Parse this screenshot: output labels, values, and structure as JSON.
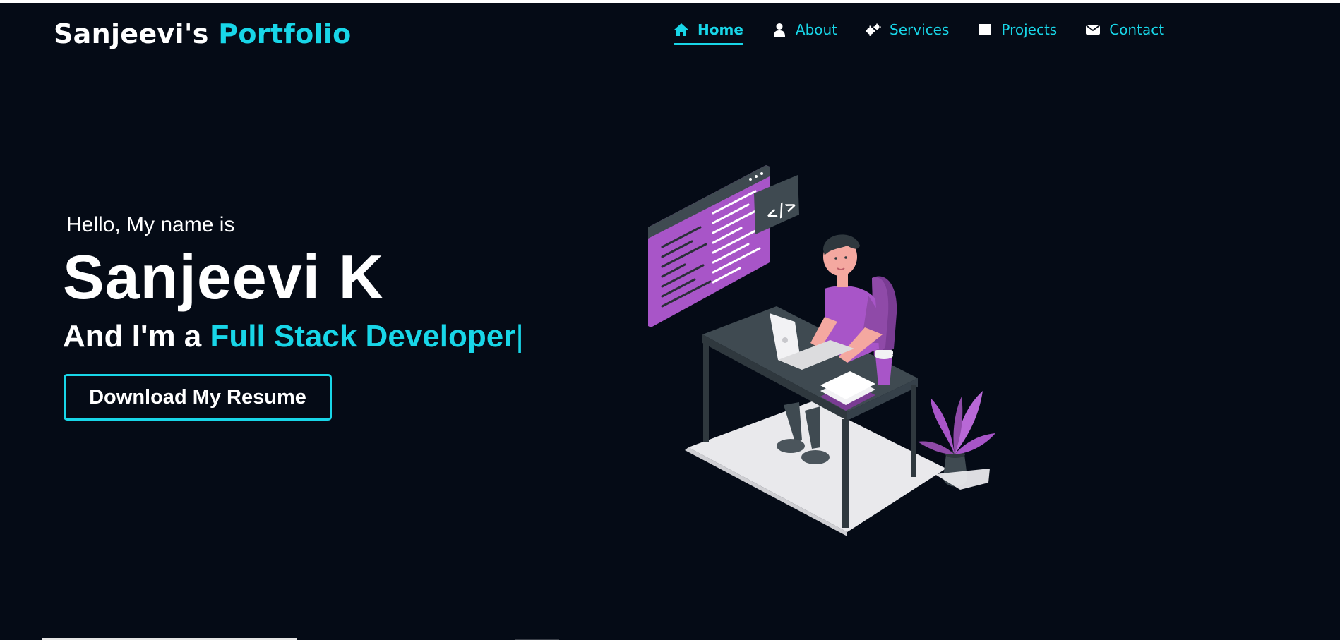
{
  "brand": {
    "name": "Sanjeevi's",
    "accent": "Portfolio"
  },
  "nav": {
    "items": [
      {
        "label": "Home",
        "icon": "home-icon",
        "active": true
      },
      {
        "label": "About",
        "icon": "user-icon",
        "active": false
      },
      {
        "label": "Services",
        "icon": "gears-icon",
        "active": false
      },
      {
        "label": "Projects",
        "icon": "archive-icon",
        "active": false
      },
      {
        "label": "Contact",
        "icon": "envelope-icon",
        "active": false
      }
    ]
  },
  "hero": {
    "greeting": "Hello, My name is",
    "name": "Sanjeevi K",
    "role_prefix": "And I'm a ",
    "role_typed": "Full Stack Developer",
    "cursor": "|",
    "button_label": "Download My Resume"
  },
  "illustration": {
    "name": "developer-at-desk-illustration",
    "code_tag": "</>"
  },
  "colors": {
    "background": "#050b16",
    "accent": "#18d6e8",
    "text": "#ffffff",
    "purple": "#a855c8",
    "desk": "#3f4a51"
  }
}
